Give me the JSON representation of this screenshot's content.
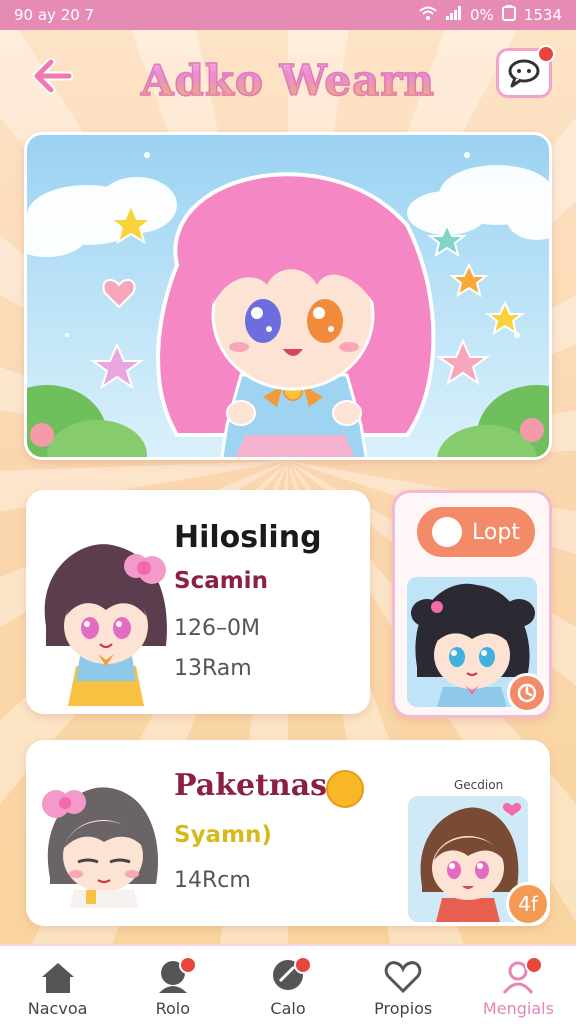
{
  "status_bar": {
    "left": "90 ay 20 7",
    "battery": "0%",
    "time": "1534"
  },
  "header": {
    "title": "Adko Wearn"
  },
  "cards": [
    {
      "title": "Hilosling",
      "subtitle": "Scamin",
      "line1": "126–0M",
      "line2": "13Ram"
    },
    {
      "title": "Paketnas",
      "subtitle": "Syamn)",
      "line1": "14Rcm"
    }
  ],
  "side_card": {
    "button_label": "Lopt"
  },
  "card2_corner_label": "4f",
  "card2_caption": "Gecdion",
  "tabs": [
    {
      "label": "Nacvoa",
      "icon": "home-icon"
    },
    {
      "label": "Rolo",
      "icon": "person-icon"
    },
    {
      "label": "Calo",
      "icon": "chat-icon"
    },
    {
      "label": "Propios",
      "icon": "heart-icon"
    },
    {
      "label": "Mengials",
      "icon": "profile-icon"
    }
  ],
  "colors": {
    "accent_pink": "#e983b5",
    "status_bar": "#e58bb4",
    "button_orange": "#f38a68",
    "badge_red": "#e8453c"
  }
}
